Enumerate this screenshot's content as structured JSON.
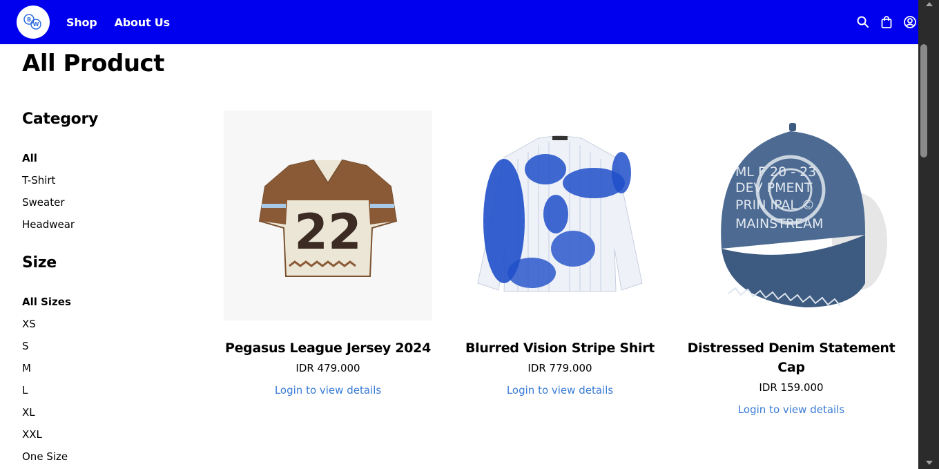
{
  "nav": {
    "logo_text": "BW",
    "links": [
      "Shop",
      "About Us"
    ],
    "icons": [
      "search-icon",
      "shopping-bag-icon",
      "user-account-icon"
    ],
    "bg_color": "#0000ee"
  },
  "page_title": "All Product",
  "filters": {
    "category": {
      "heading": "Category",
      "items": [
        "All",
        "T-Shirt",
        "Sweater",
        "Headwear"
      ],
      "active": "All"
    },
    "size": {
      "heading": "Size",
      "items": [
        "All Sizes",
        "XS",
        "S",
        "M",
        "L",
        "XL",
        "XXL",
        "One Size"
      ],
      "active": "All Sizes"
    }
  },
  "products": [
    {
      "name": "Pegasus League Jersey 2024",
      "price": "IDR 479.000",
      "link": "Login to view details"
    },
    {
      "name": "Blurred Vision Stripe Shirt",
      "price": "IDR 779.000",
      "link": "Login to view details"
    },
    {
      "name": "Distressed Denim Statement Cap",
      "price": "IDR 159.000",
      "link": "Login to view details"
    }
  ],
  "colors": {
    "link": "#3a7bd5",
    "nav": "#0000ee"
  }
}
